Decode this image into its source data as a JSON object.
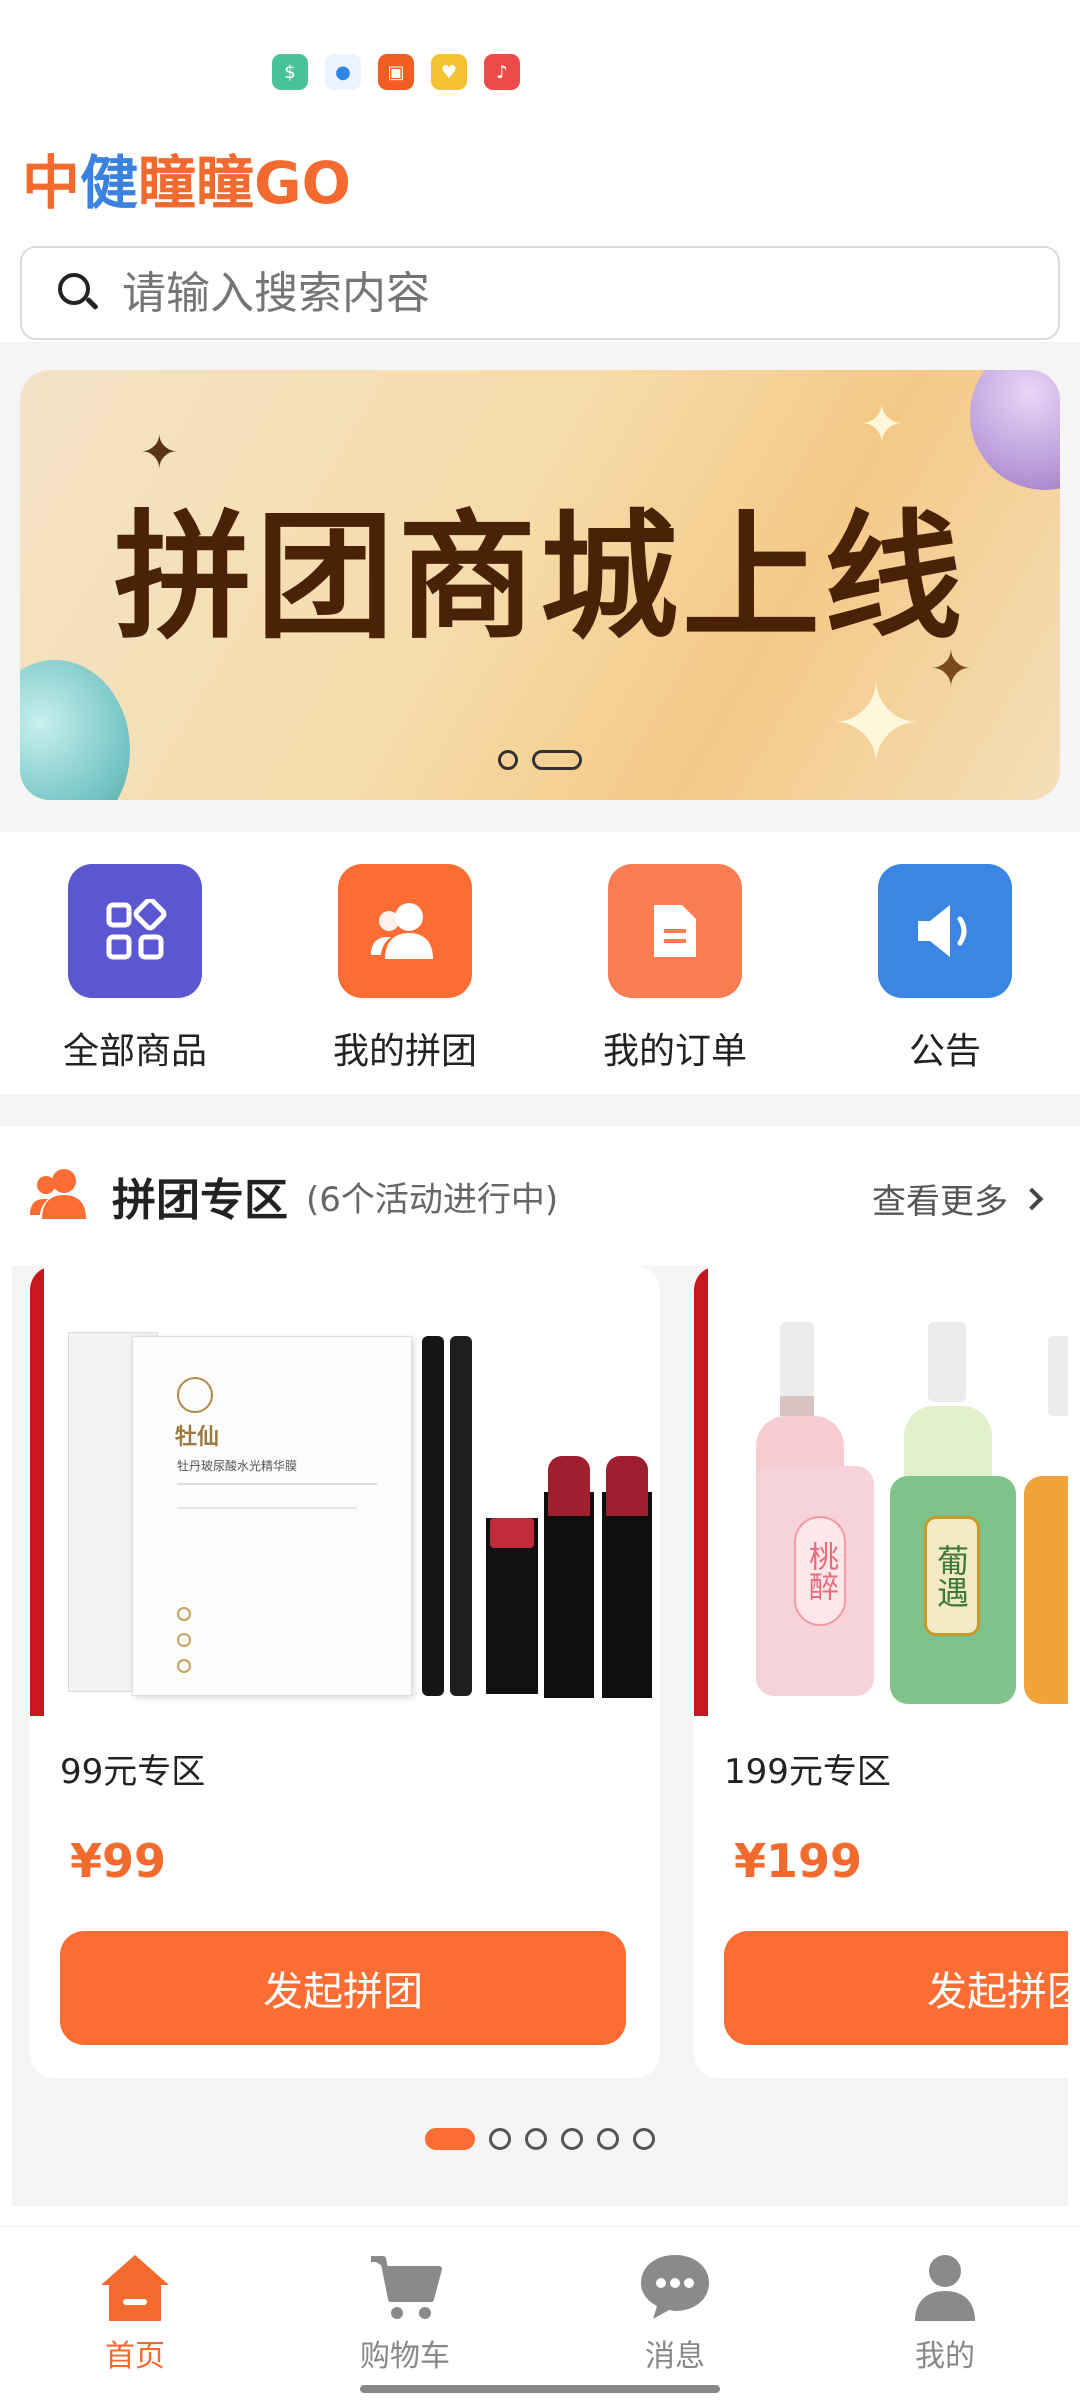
{
  "brand": {
    "part1": "中",
    "part2": "健",
    "part3": "瞳瞳GO"
  },
  "search": {
    "placeholder": "请输入搜索内容"
  },
  "banner": {
    "title": "拼团商城上线"
  },
  "quick_menu": [
    {
      "label": "全部商品",
      "icon": "grid-icon",
      "color": "#5b57d1"
    },
    {
      "label": "我的拼团",
      "icon": "people-icon",
      "color": "#fb6d32"
    },
    {
      "label": "我的订单",
      "icon": "document-icon",
      "color": "#fb7d52"
    },
    {
      "label": "公告",
      "icon": "speaker-icon",
      "color": "#3b86e3"
    }
  ],
  "group_section": {
    "title": "拼团专区",
    "subtitle": "(6个活动进行中)",
    "more": "查看更多"
  },
  "cards": [
    {
      "name": "99元专区",
      "price": "¥99",
      "button": "发起拼团"
    },
    {
      "name": "199元专区",
      "price": "¥199",
      "button": "发起拼团"
    }
  ],
  "product_art": {
    "mask_brand": "牡仙",
    "mask_name": "牡丹玻尿酸水光精华膜",
    "liquor1": "桃醉",
    "liquor2": "葡遇"
  },
  "bottom_nav": [
    {
      "label": "首页",
      "active": true
    },
    {
      "label": "购物车",
      "active": false
    },
    {
      "label": "消息",
      "active": false
    },
    {
      "label": "我的",
      "active": false
    }
  ],
  "colors": {
    "accent": "#fb6d32",
    "brand_blue": "#3b82e0"
  }
}
